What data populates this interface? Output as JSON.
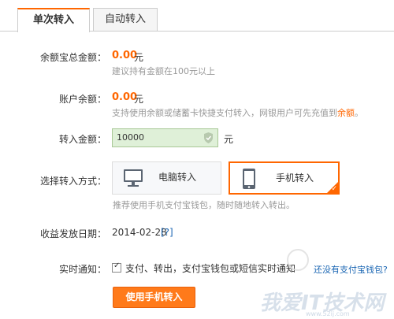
{
  "tabs": [
    {
      "label": "单次转入",
      "active": true
    },
    {
      "label": "自动转入",
      "active": false
    }
  ],
  "balance_total": {
    "label": "余额宝总金额：",
    "amount": "0.00",
    "unit": "元",
    "hint": "建议持有金额在100元以上"
  },
  "account_balance": {
    "label": "账户余额：",
    "amount": "0.00",
    "unit": "元",
    "hint_prefix": "支持使用余额或储蓄卡快捷支付转入，网银用户可先充值到",
    "hint_link": "余额",
    "hint_suffix": "。"
  },
  "transfer_amount": {
    "label": "转入金额：",
    "value": "10000",
    "unit": "元"
  },
  "method": {
    "label": "选择转入方式：",
    "options": [
      {
        "label": "电脑转入",
        "icon": "monitor-icon",
        "selected": false
      },
      {
        "label": "手机转入",
        "icon": "phone-icon",
        "selected": true
      }
    ],
    "hint": "推荐使用手机支付宝钱包，随时随地转入转出。"
  },
  "payout_date": {
    "label": "收益发放日期：",
    "value": "2014-02-28",
    "help": "[?]"
  },
  "notify": {
    "label": "实时通知：",
    "checked": true,
    "text": "支付、转出，支付宝钱包或短信实时通知",
    "link": "还没有支付宝钱包?"
  },
  "submit_label": "使用手机转入",
  "watermark": {
    "text": "我爱IT技术网",
    "url": "www.52ij.com"
  },
  "colors": {
    "accent": "#ff6600",
    "input_bg": "#dff0d8",
    "link": "#1a66b3",
    "button": "#ff7a1a"
  }
}
